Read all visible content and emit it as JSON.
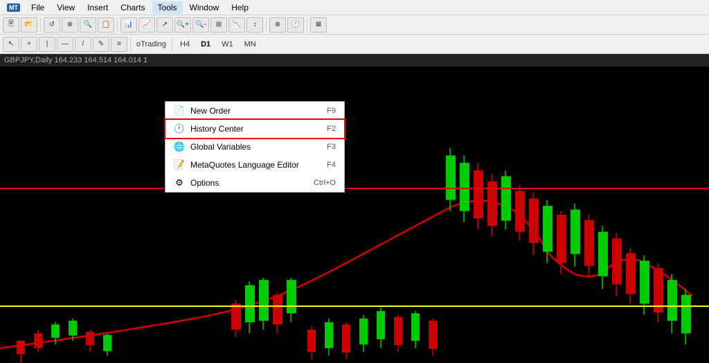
{
  "menubar": {
    "items": [
      "File",
      "View",
      "Insert",
      "Charts",
      "Tools",
      "Window",
      "Help"
    ],
    "active": "Tools"
  },
  "toolbar1": {
    "buttons": [
      "+",
      "⊞",
      "↺",
      "⊕",
      "⊙",
      "📋"
    ],
    "separator": true
  },
  "toolbar2": {
    "tools": [
      "↖",
      "+",
      "|",
      "—",
      "/",
      "✎",
      "≡"
    ],
    "timeframeLabel": "oTrading",
    "timeframes": [
      "H4",
      "D1",
      "W1",
      "MN"
    ]
  },
  "chartTitle": "GBPJPY,Daily  164.233  164.514  164.014  1",
  "dropdown": {
    "items": [
      {
        "id": "new-order",
        "icon": "📄",
        "label": "New Order",
        "shortcut": "F9",
        "highlighted": false
      },
      {
        "id": "history-center",
        "icon": "🕐",
        "label": "History Center",
        "shortcut": "F2",
        "highlighted": true
      },
      {
        "id": "global-variables",
        "icon": "🌐",
        "label": "Global Variables",
        "shortcut": "F3",
        "highlighted": false
      },
      {
        "id": "metaquotes-editor",
        "icon": "📝",
        "label": "MetaQuotes Language Editor",
        "shortcut": "F4",
        "highlighted": false
      },
      {
        "id": "options",
        "icon": "⚙",
        "label": "Options",
        "shortcut": "Ctrl+O",
        "highlighted": false
      }
    ]
  },
  "chart": {
    "redLineTop": 175,
    "yellowLineY": 345,
    "candleColor": {
      "bull": "#00cc00",
      "bear": "#cc0000"
    }
  }
}
